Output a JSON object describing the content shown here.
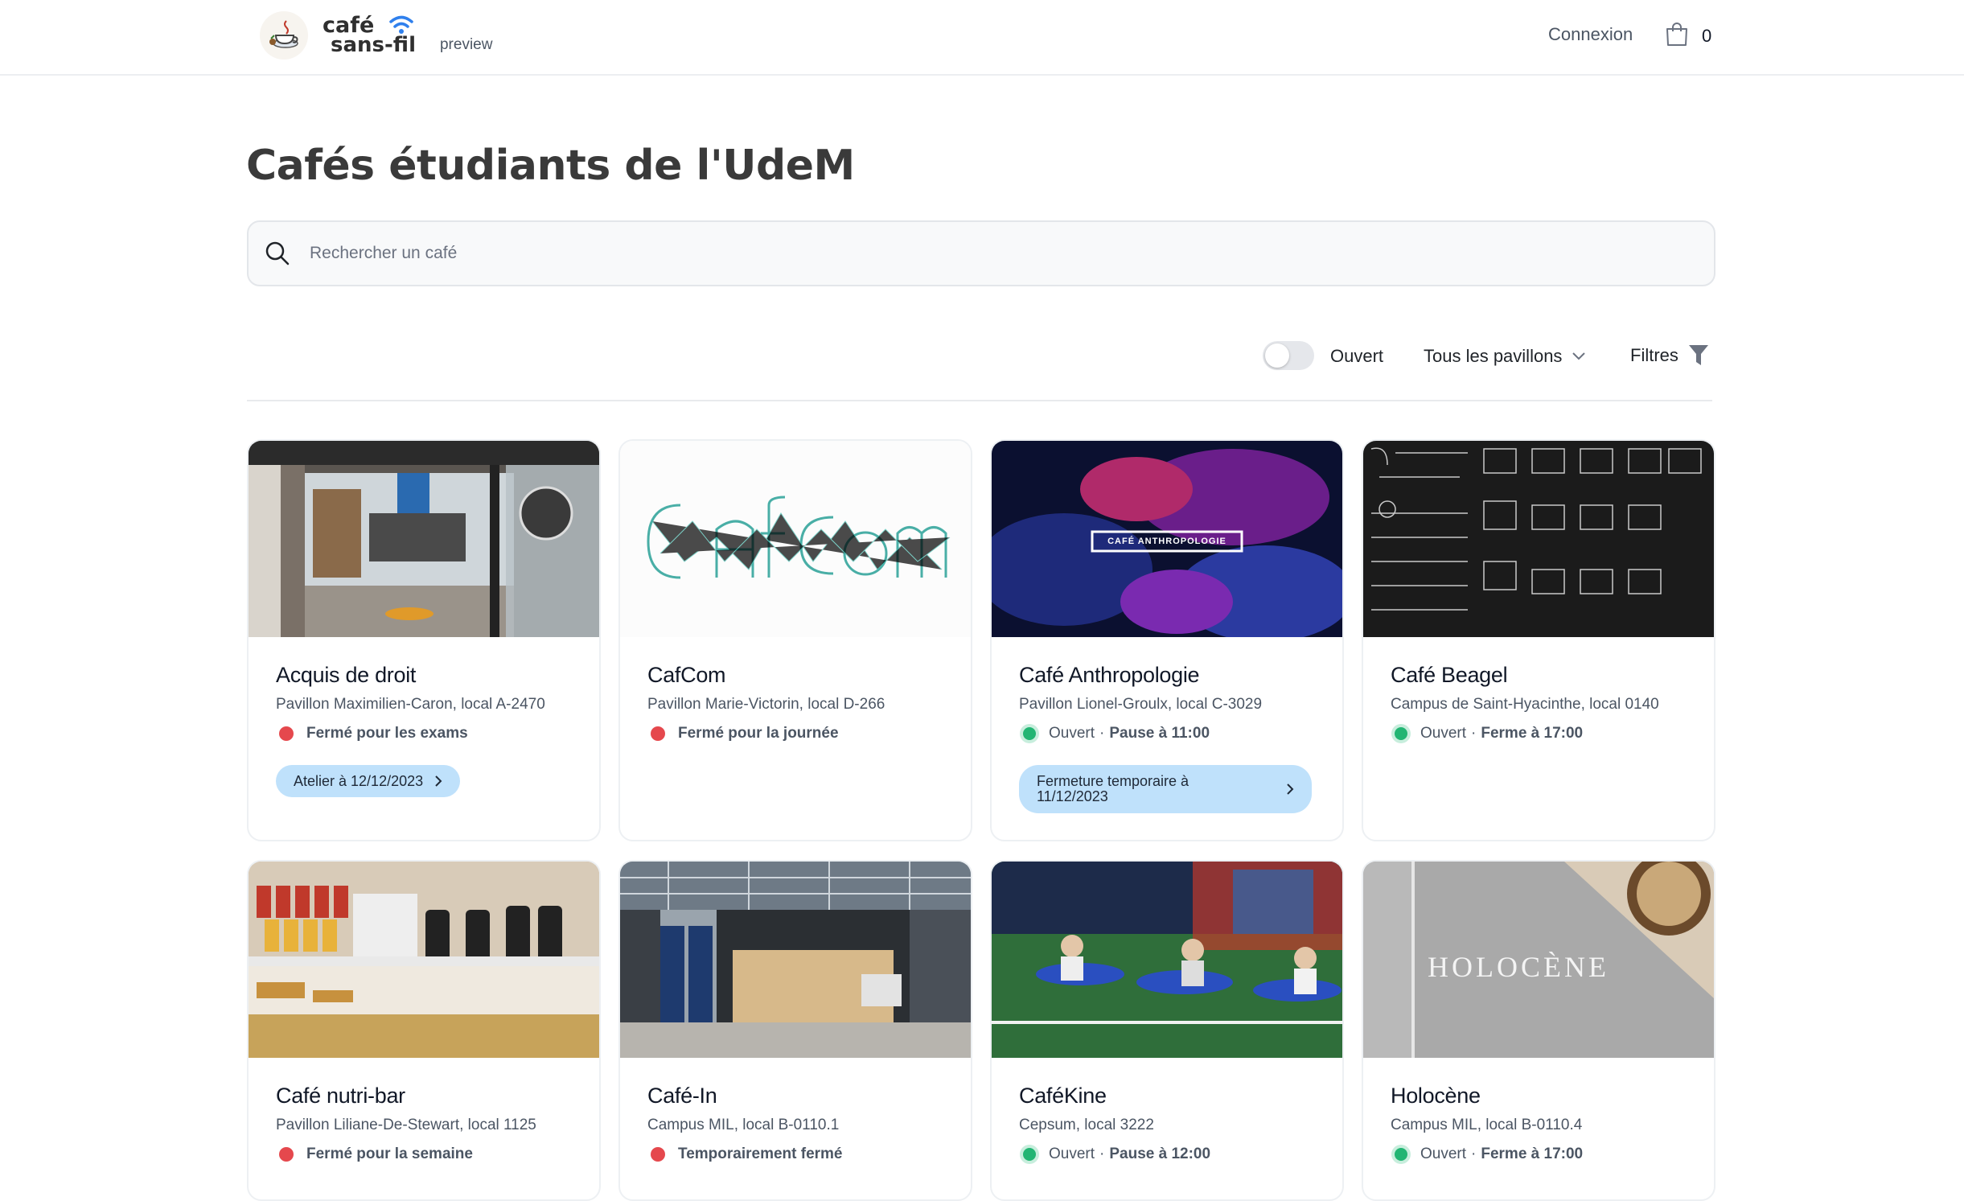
{
  "header": {
    "logo_line1": "café",
    "logo_line2": "sans-fil",
    "preview": "preview",
    "login": "Connexion",
    "cart_count": "0"
  },
  "page": {
    "title": "Cafés étudiants de l'UdeM"
  },
  "search": {
    "placeholder": "Rechercher un café"
  },
  "filters": {
    "open_label": "Ouvert",
    "open_toggle": false,
    "pavilions_label": "Tous les pavillons",
    "filters_label": "Filtres"
  },
  "colors": {
    "closed": "#e5484d",
    "open": "#22b573",
    "pill": "#bfe1fb"
  },
  "cafes": [
    {
      "name": "Acquis de droit",
      "location": "Pavillon Maximilien-Caron, local A-2470",
      "status": "Fermé pour les exams",
      "open": false,
      "pill": "Atelier à 12/12/2023"
    },
    {
      "name": "CafCom",
      "location": "Pavillon Marie-Victorin, local D-266",
      "status": "Fermé pour la journée",
      "open": false
    },
    {
      "name": "Café Anthropologie",
      "location": "Pavillon Lionel-Groulx, local C-3029",
      "status": "Ouvert",
      "detail": "Pause à 11:00",
      "open": true,
      "pill": "Fermeture temporaire à 11/12/2023",
      "image_text": "CAFÉ ANTHROPOLOGIE"
    },
    {
      "name": "Café Beagel",
      "location": "Campus de Saint-Hyacinthe, local 0140",
      "status": "Ouvert",
      "detail": "Ferme à 17:00",
      "open": true
    },
    {
      "name": "Café nutri-bar",
      "location": "Pavillon Liliane-De-Stewart, local 1125",
      "status": "Fermé pour la semaine",
      "open": false
    },
    {
      "name": "Café-In",
      "location": "Campus MIL, local B-0110.1",
      "status": "Temporairement fermé",
      "open": false
    },
    {
      "name": "CaféKine",
      "location": "Cepsum, local 3222",
      "status": "Ouvert",
      "detail": "Pause à 12:00",
      "open": true
    },
    {
      "name": "Holocène",
      "location": "Campus MIL, local B-0110.4",
      "status": "Ouvert",
      "detail": "Ferme à 17:00",
      "open": true,
      "image_text": "HOLOCÈNE"
    }
  ]
}
